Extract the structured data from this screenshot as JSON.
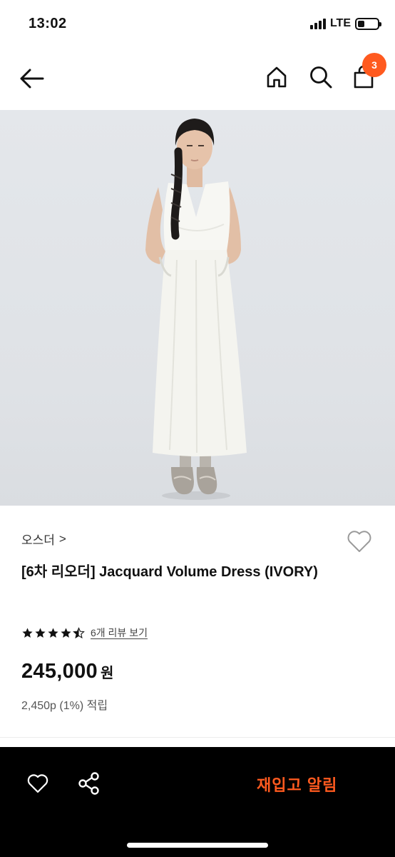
{
  "status": {
    "time": "13:02",
    "network": "LTE",
    "battery_level": 0.35
  },
  "nav": {
    "back_icon": "back-arrow-icon",
    "home_icon": "home-icon",
    "search_icon": "search-icon",
    "cart_icon": "shopping-bag-icon",
    "cart_count": "3"
  },
  "product": {
    "brand": "오스더",
    "brand_chevron": ">",
    "title": "[6차 리오더] Jacquard Volume Dress (IVORY)",
    "rating": 4.5,
    "review_link": "6개 리뷰 보기",
    "price": "245,000",
    "currency": "원",
    "points": "2,450p (1%) 적립"
  },
  "bottom": {
    "wish_icon": "heart-icon",
    "share_icon": "share-icon",
    "restock_label": "재입고 알림"
  },
  "colors": {
    "accent": "#ff5a1f",
    "bar": "#000000"
  }
}
